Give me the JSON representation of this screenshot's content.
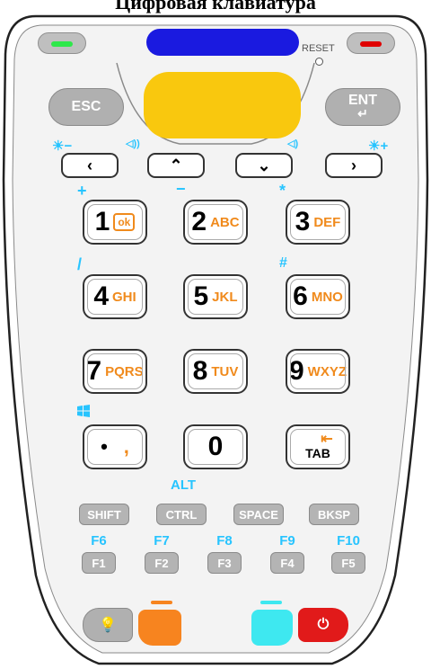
{
  "title": "Цифровая клавиатура",
  "colors": {
    "led_green": "#2ee84a",
    "led_red": "#e00000",
    "scan_blue": "#1a1ae0",
    "scan_yellow": "#f9c80e",
    "fn_label": "#27c4ff",
    "letters": "#f08a1c",
    "orange_key": "#f7841f",
    "cyan_key": "#3ee8f0",
    "power_red": "#e11a1a"
  },
  "reset_label": "RESET",
  "esc_label": "ESC",
  "ent_label": "ENT",
  "nav": {
    "brightness_down": "☀−",
    "volume_up": "◁))",
    "volume_down": "◁)",
    "brightness_up": "☀+",
    "left": "‹",
    "up": "⌃",
    "down": "⌄",
    "right": "›"
  },
  "shift_symbols": {
    "plus": "+",
    "minus": "−",
    "star": "*",
    "slash": "/",
    "hash": "#"
  },
  "keys": [
    {
      "digit": "1",
      "letters": "ok"
    },
    {
      "digit": "2",
      "letters": "ABC"
    },
    {
      "digit": "3",
      "letters": "DEF"
    },
    {
      "digit": "4",
      "letters": "GHI"
    },
    {
      "digit": "5",
      "letters": "JKL"
    },
    {
      "digit": "6",
      "letters": "MNO"
    },
    {
      "digit": "7",
      "letters": "PQRS"
    },
    {
      "digit": "8",
      "letters": "TUV"
    },
    {
      "digit": "9",
      "letters": "WXYZ"
    }
  ],
  "dot_key": {
    "dot": "•",
    "comma": ","
  },
  "zero_key": "0",
  "tab_key": "TAB",
  "alt_label": "ALT",
  "modifiers": [
    "SHIFT",
    "CTRL",
    "SPACE",
    "BKSP"
  ],
  "f_labels": [
    "F6",
    "F7",
    "F8",
    "F9",
    "F10"
  ],
  "f_keys": [
    "F1",
    "F2",
    "F3",
    "F4",
    "F5"
  ],
  "icons": {
    "windows": "windows-icon",
    "light": "lightbulb-icon",
    "power": "power-icon",
    "tab_arrow": "tab-arrow-icon"
  }
}
